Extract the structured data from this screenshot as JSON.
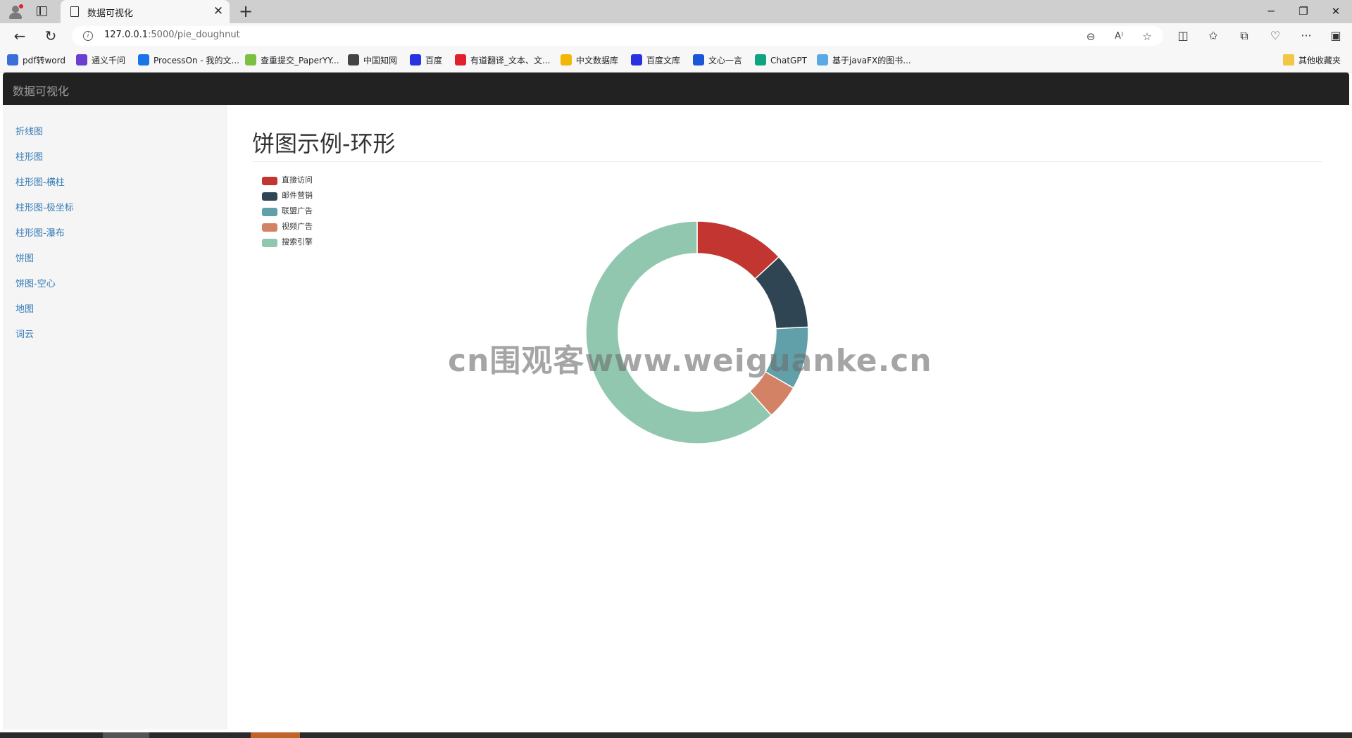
{
  "browser": {
    "tab_title": "数据可视化",
    "url_host": "127.0.0.1",
    "url_rest": ":5000/pie_doughnut",
    "bookmarks": [
      {
        "label": "pdf转word",
        "icon": "pdf-convert-icon",
        "color": "#3b6fd8"
      },
      {
        "label": "通义千问",
        "icon": "tongyi-icon",
        "color": "#6a3fd0"
      },
      {
        "label": "ProcessOn - 我的文...",
        "icon": "processon-icon",
        "color": "#1a73e8"
      },
      {
        "label": "查重提交_PaperYY...",
        "icon": "paperyy-icon",
        "color": "#7bc043"
      },
      {
        "label": "中国知网",
        "icon": "cnki-icon",
        "color": "#444444"
      },
      {
        "label": "百度",
        "icon": "baidu-icon",
        "color": "#2932e1"
      },
      {
        "label": "有道翻译_文本、文...",
        "icon": "youdao-icon",
        "color": "#e0202a"
      },
      {
        "label": "中文数据库",
        "icon": "location-pin-icon",
        "color": "#f2b705"
      },
      {
        "label": "百度文库",
        "icon": "baidu-wenku-icon",
        "color": "#2932e1"
      },
      {
        "label": "文心一言",
        "icon": "wenxin-icon",
        "color": "#1a57d6"
      },
      {
        "label": "ChatGPT",
        "icon": "chatgpt-icon",
        "color": "#10a37f"
      },
      {
        "label": "基于javaFX的图书...",
        "icon": "page-icon",
        "color": "#5aa9e6"
      }
    ],
    "other_bookmarks": "其他收藏夹"
  },
  "page": {
    "brand": "数据可视化",
    "title": "饼图示例-环形",
    "sidebar": [
      "折线图",
      "柱形图",
      "柱形图-横柱",
      "柱形图-极坐标",
      "柱形图-瀑布",
      "饼图",
      "饼图-空心",
      "地图",
      "词云"
    ],
    "link_color": "#337ab7",
    "watermark": "cn围观客www.weiguanke.cn"
  },
  "chart_data": {
    "type": "pie",
    "variant": "doughnut",
    "legend_position": "top-left",
    "series": [
      {
        "name": "直接访问",
        "value": 13,
        "color": "#c23531"
      },
      {
        "name": "邮件营销",
        "value": 11,
        "color": "#2f4554"
      },
      {
        "name": "联盟广告",
        "value": 9,
        "color": "#61a0a8"
      },
      {
        "name": "视频广告",
        "value": 5,
        "color": "#d48265"
      },
      {
        "name": "搜索引擎",
        "value": 61,
        "color": "#91c7ae"
      }
    ]
  }
}
